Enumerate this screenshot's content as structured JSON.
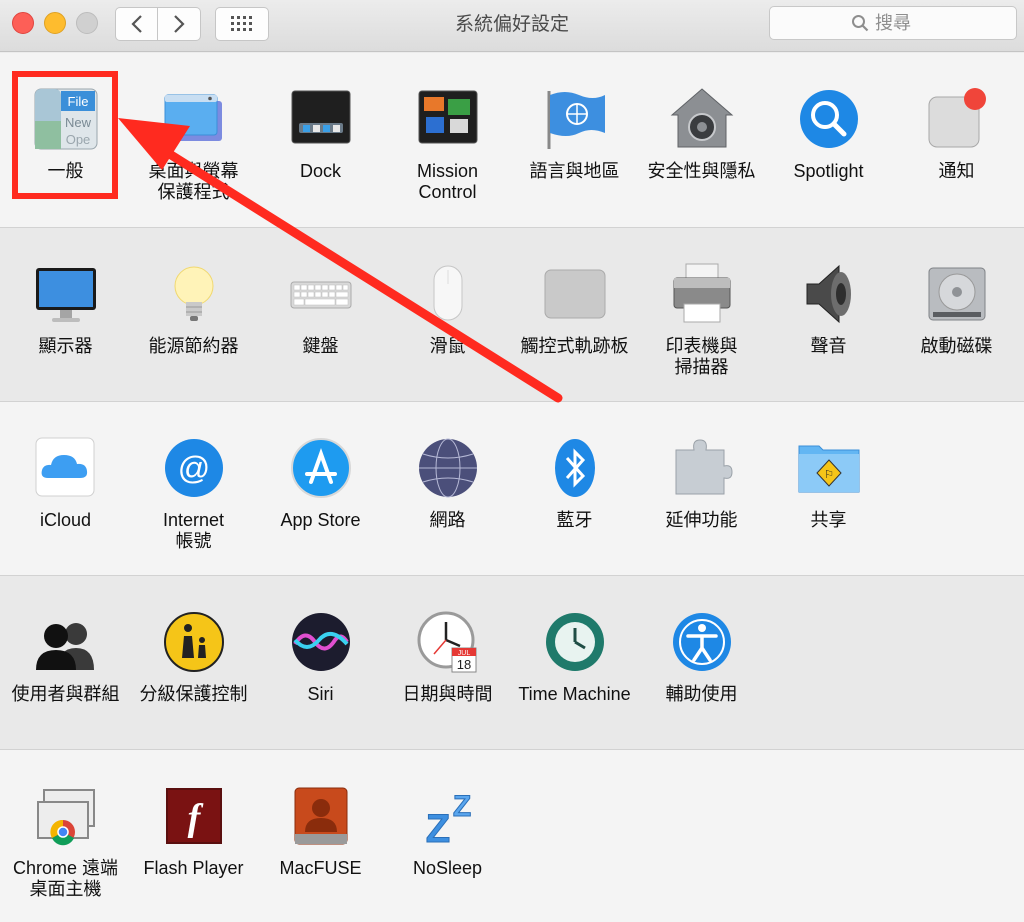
{
  "window": {
    "title": "系統偏好設定",
    "search_placeholder": "搜尋"
  },
  "rows": [
    {
      "items": [
        {
          "id": "general",
          "label": "一般",
          "icon": "general-icon"
        },
        {
          "id": "desktop",
          "label": "桌面與螢幕\n保護程式",
          "icon": "desktop-screensaver-icon"
        },
        {
          "id": "dock",
          "label": "Dock",
          "icon": "dock-icon"
        },
        {
          "id": "mission",
          "label": "Mission\nControl",
          "icon": "mission-control-icon"
        },
        {
          "id": "language",
          "label": "語言與地區",
          "icon": "language-region-icon"
        },
        {
          "id": "security",
          "label": "安全性與隱私",
          "icon": "security-privacy-icon"
        },
        {
          "id": "spotlight",
          "label": "Spotlight",
          "icon": "spotlight-icon"
        },
        {
          "id": "notifications",
          "label": "通知",
          "icon": "notifications-icon"
        }
      ]
    },
    {
      "items": [
        {
          "id": "displays",
          "label": "顯示器",
          "icon": "displays-icon"
        },
        {
          "id": "energy",
          "label": "能源節約器",
          "icon": "energy-saver-icon"
        },
        {
          "id": "keyboard",
          "label": "鍵盤",
          "icon": "keyboard-icon"
        },
        {
          "id": "mouse",
          "label": "滑鼠",
          "icon": "mouse-icon"
        },
        {
          "id": "trackpad",
          "label": "觸控式軌跡板",
          "icon": "trackpad-icon"
        },
        {
          "id": "printers",
          "label": "印表機與\n掃描器",
          "icon": "printer-icon"
        },
        {
          "id": "sound",
          "label": "聲音",
          "icon": "sound-icon"
        },
        {
          "id": "startup",
          "label": "啟動磁碟",
          "icon": "startup-disk-icon"
        }
      ]
    },
    {
      "items": [
        {
          "id": "icloud",
          "label": "iCloud",
          "icon": "icloud-icon"
        },
        {
          "id": "internet",
          "label": "Internet\n帳號",
          "icon": "internet-accounts-icon"
        },
        {
          "id": "appstore",
          "label": "App Store",
          "icon": "app-store-icon"
        },
        {
          "id": "network",
          "label": "網路",
          "icon": "network-icon"
        },
        {
          "id": "bluetooth",
          "label": "藍牙",
          "icon": "bluetooth-icon"
        },
        {
          "id": "extensions",
          "label": "延伸功能",
          "icon": "extensions-icon"
        },
        {
          "id": "sharing",
          "label": "共享",
          "icon": "sharing-icon"
        }
      ]
    },
    {
      "items": [
        {
          "id": "users",
          "label": "使用者與群組",
          "icon": "users-groups-icon"
        },
        {
          "id": "parental",
          "label": "分級保護控制",
          "icon": "parental-controls-icon"
        },
        {
          "id": "siri",
          "label": "Siri",
          "icon": "siri-icon"
        },
        {
          "id": "datetime",
          "label": "日期與時間",
          "icon": "date-time-icon"
        },
        {
          "id": "timemachine",
          "label": "Time Machine",
          "icon": "time-machine-icon"
        },
        {
          "id": "accessibility",
          "label": "輔助使用",
          "icon": "accessibility-icon"
        }
      ]
    },
    {
      "items": [
        {
          "id": "chromeremote",
          "label": "Chrome 遠端\n桌面主機",
          "icon": "chrome-remote-desktop-icon"
        },
        {
          "id": "flash",
          "label": "Flash Player",
          "icon": "flash-player-icon"
        },
        {
          "id": "macfuse",
          "label": "MacFUSE",
          "icon": "macfuse-icon"
        },
        {
          "id": "nosleep",
          "label": "NoSleep",
          "icon": "nosleep-icon"
        }
      ]
    }
  ],
  "icon_text": {
    "general_file": "File",
    "general_new": "New",
    "general_open": "Ope",
    "calendar_month": "JUL",
    "calendar_day": "18",
    "flash_glyph": "f",
    "nosleep_glyph": "Z"
  },
  "colors": {
    "annotation_red": "#ff2a1f",
    "accent_blue": "#1e88e5"
  }
}
